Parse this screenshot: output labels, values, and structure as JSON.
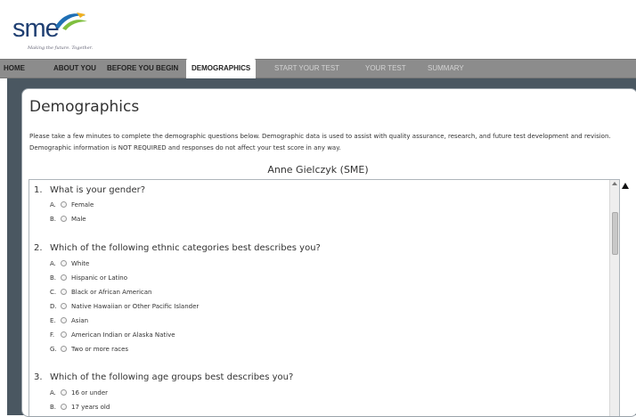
{
  "brand": {
    "logo_text": "sme",
    "tagline": "Making the future. Together."
  },
  "nav": [
    {
      "label": "HOME",
      "state": "normal"
    },
    {
      "label": "ABOUT YOU",
      "state": "normal"
    },
    {
      "label": "BEFORE YOU BEGIN",
      "state": "normal"
    },
    {
      "label": "DEMOGRAPHICS",
      "state": "active"
    },
    {
      "label": "START YOUR TEST",
      "state": "disabled"
    },
    {
      "label": "YOUR TEST",
      "state": "disabled"
    },
    {
      "label": "SUMMARY",
      "state": "disabled"
    }
  ],
  "page": {
    "title": "Demographics",
    "intro": "Please take a few minutes to complete the demographic questions below. Demographic data is used to assist with quality assurance, research, and future test development and revision. Demographic information is NOT REQUIRED and responses do not affect your test score in any way.",
    "candidate": "Anne Gielczyk (SME)"
  },
  "questions": [
    {
      "number": "1.",
      "text": "What is your gender?",
      "options": [
        {
          "letter": "A.",
          "label": "Female"
        },
        {
          "letter": "B.",
          "label": "Male"
        }
      ]
    },
    {
      "number": "2.",
      "text": "Which of the following ethnic categories best describes you?",
      "options": [
        {
          "letter": "A.",
          "label": "White"
        },
        {
          "letter": "B.",
          "label": "Hispanic or Latino"
        },
        {
          "letter": "C.",
          "label": "Black or African American"
        },
        {
          "letter": "D.",
          "label": "Native Hawaiian or Other Pacific Islander"
        },
        {
          "letter": "E.",
          "label": "Asian"
        },
        {
          "letter": "F.",
          "label": "American Indian or Alaska Native"
        },
        {
          "letter": "G.",
          "label": "Two or more races"
        }
      ]
    },
    {
      "number": "3.",
      "text": "Which of the following age groups best describes you?",
      "options": [
        {
          "letter": "A.",
          "label": "16 or under"
        },
        {
          "letter": "B.",
          "label": "17 years old"
        }
      ]
    }
  ],
  "colors": {
    "brand_blue": "#1f3f72",
    "brand_green": "#7fbf3f",
    "nav_bg": "#8c8c8c",
    "frame_bg": "#4a5761"
  },
  "icons": {
    "scroll_up": "triangle-up",
    "page_marker": "triangle-up"
  }
}
